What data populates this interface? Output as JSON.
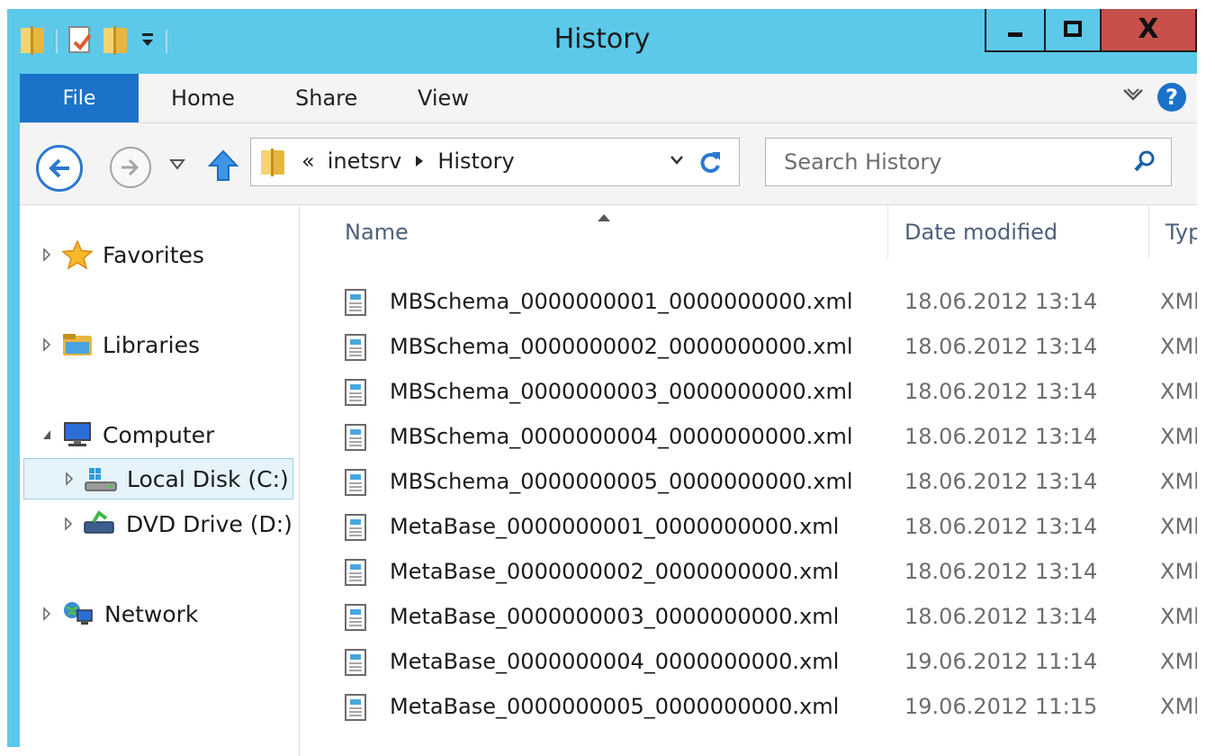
{
  "window": {
    "title": "History",
    "close_glyph": "X"
  },
  "ribbon": {
    "tabs": [
      {
        "label": "File"
      },
      {
        "label": "Home"
      },
      {
        "label": "Share"
      },
      {
        "label": "View"
      }
    ]
  },
  "address": {
    "overflow": "«",
    "crumbs": [
      "inetsrv",
      "History"
    ]
  },
  "search": {
    "placeholder": "Search History"
  },
  "sidebar": {
    "items": [
      {
        "label": "Favorites",
        "icon": "star-icon"
      },
      {
        "label": "Libraries",
        "icon": "libraries-icon"
      },
      {
        "label": "Computer",
        "icon": "computer-icon"
      },
      {
        "label": "Local Disk (C:)",
        "icon": "local-disk-icon"
      },
      {
        "label": "DVD Drive (D:)",
        "icon": "dvd-drive-icon"
      },
      {
        "label": "Network",
        "icon": "network-icon"
      }
    ]
  },
  "columns": {
    "name": "Name",
    "date": "Date modified",
    "type": "Typ"
  },
  "files": [
    {
      "name": "MBSchema_0000000001_0000000000.xml",
      "date": "18.06.2012 13:14",
      "type": "XMl"
    },
    {
      "name": "MBSchema_0000000002_0000000000.xml",
      "date": "18.06.2012 13:14",
      "type": "XMl"
    },
    {
      "name": "MBSchema_0000000003_0000000000.xml",
      "date": "18.06.2012 13:14",
      "type": "XMl"
    },
    {
      "name": "MBSchema_0000000004_0000000000.xml",
      "date": "18.06.2012 13:14",
      "type": "XMl"
    },
    {
      "name": "MBSchema_0000000005_0000000000.xml",
      "date": "18.06.2012 13:14",
      "type": "XMl"
    },
    {
      "name": "MetaBase_0000000001_0000000000.xml",
      "date": "18.06.2012 13:14",
      "type": "XMl"
    },
    {
      "name": "MetaBase_0000000002_0000000000.xml",
      "date": "18.06.2012 13:14",
      "type": "XMl"
    },
    {
      "name": "MetaBase_0000000003_0000000000.xml",
      "date": "18.06.2012 13:14",
      "type": "XMl"
    },
    {
      "name": "MetaBase_0000000004_0000000000.xml",
      "date": "19.06.2012 11:14",
      "type": "XMl"
    },
    {
      "name": "MetaBase_0000000005_0000000000.xml",
      "date": "19.06.2012 11:15",
      "type": "XMl"
    }
  ],
  "colors": {
    "titlebar": "#5cc9ea",
    "file_tab": "#1a72c9",
    "close_button": "#c7504a",
    "selection": "#e5f3fb"
  }
}
